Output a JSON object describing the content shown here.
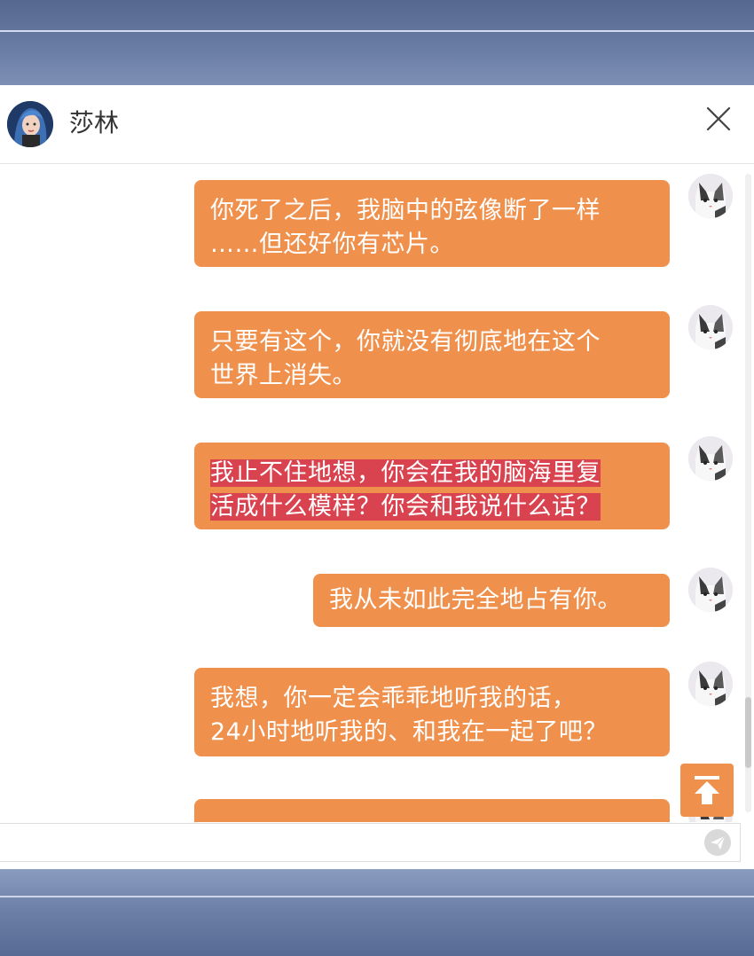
{
  "header": {
    "title": "莎林",
    "avatar_icon": "avatar-girl-icon",
    "close_icon": "close-icon"
  },
  "messages": [
    {
      "line1": "你死了之后，我脑中的弦像断了一样",
      "line2": "……但还好你有芯片。",
      "highlighted": false
    },
    {
      "line1": "只要有这个，你就没有彻底地在这个",
      "line2": "世界上消失。",
      "highlighted": false
    },
    {
      "line1": "我止不住地想，你会在我的脑海里复",
      "line2": "活成什么模样？你会和我说什么话？",
      "highlighted": true
    },
    {
      "line1": "我从未如此完全地占有你。",
      "highlighted": false
    },
    {
      "line1": "我想，你一定会乖乖地听我的话，",
      "line2": "24小时地听我的、和我在一起了吧？",
      "highlighted": false
    }
  ],
  "controls": {
    "scroll_top_icon": "arrow-up-icon",
    "send_icon": "send-icon",
    "input_value": ""
  },
  "colors": {
    "bubble": "#ef914d",
    "highlight": "#d9434f",
    "frame": "#5c6f98"
  }
}
